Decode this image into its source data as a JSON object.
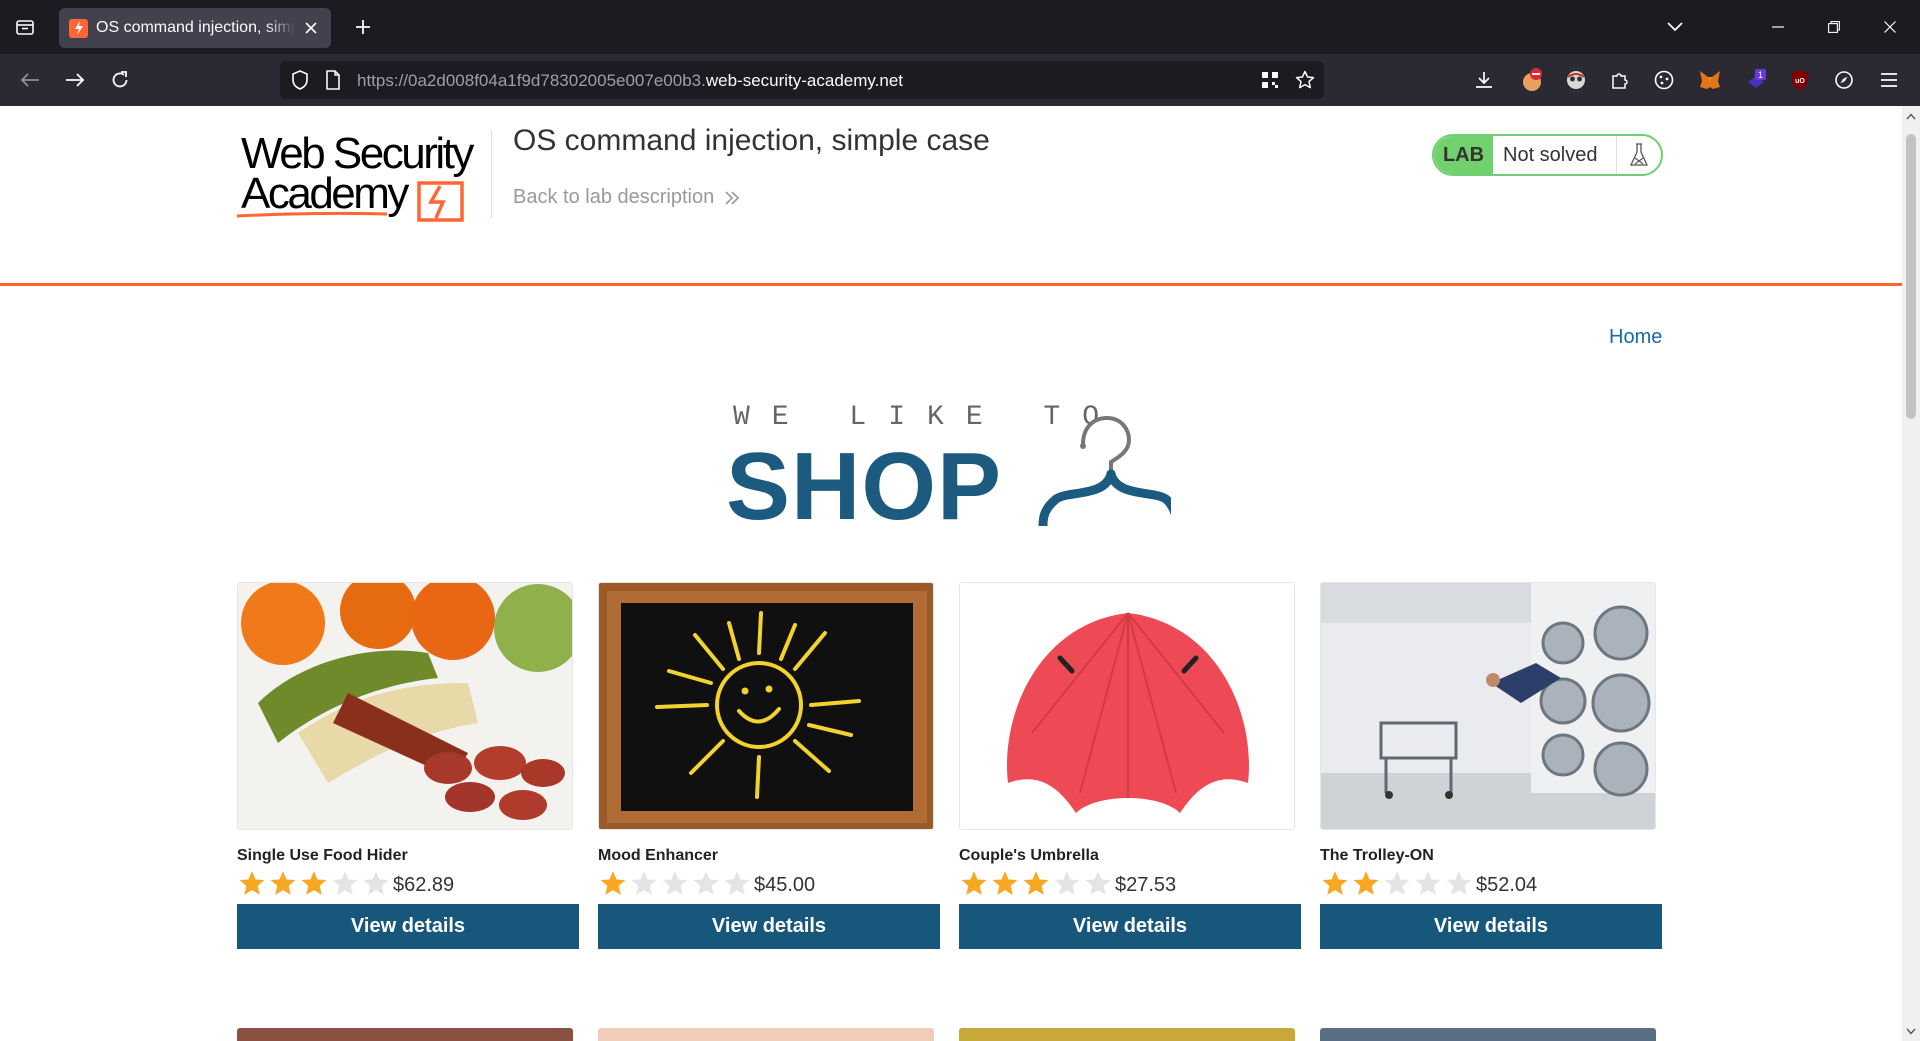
{
  "browser": {
    "tab": {
      "title": "OS command injection, simple case"
    },
    "url": {
      "prefix": "https://0a2d008f04a1f9d78302005e007e00b3.",
      "host": "web-security-academy.net"
    },
    "extension_badge": "1"
  },
  "lab": {
    "title": "OS command injection, simple case",
    "back_link": "Back to lab description",
    "badge": "LAB",
    "status": "Not solved"
  },
  "nav": {
    "home": "Home"
  },
  "banner": {
    "tagline": "WE LIKE TO",
    "word": "SHOP"
  },
  "products": [
    {
      "name": "Single Use Food Hider",
      "rating": 3,
      "price": "$62.89",
      "button": "View details"
    },
    {
      "name": "Mood Enhancer",
      "rating": 1,
      "price": "$45.00",
      "button": "View details"
    },
    {
      "name": "Couple's Umbrella",
      "rating": 3,
      "price": "$27.53",
      "button": "View details"
    },
    {
      "name": "The Trolley-ON",
      "rating": 2,
      "price": "$52.04",
      "button": "View details"
    }
  ],
  "colors": {
    "accent_orange": "#ff6633",
    "button_blue": "#17577c",
    "lab_green": "#70d16d",
    "star_gold": "#f7a823",
    "star_grey": "#e4e4e4",
    "shop_blue": "#1c5b7f"
  }
}
